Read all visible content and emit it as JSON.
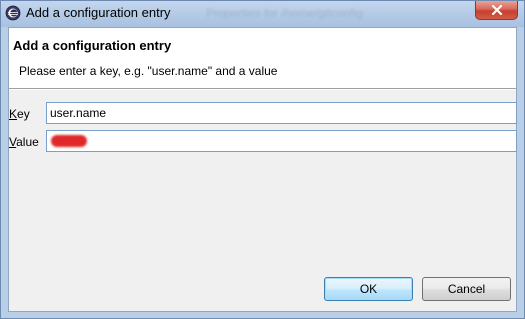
{
  "window": {
    "title": "Add a configuration entry",
    "background_title_text": "Properties for /home/gitconfig"
  },
  "header": {
    "title": "Add a configuration entry",
    "message": "Please enter a key, e.g. \"user.name\" and a value"
  },
  "form": {
    "key_label": "Key",
    "key_value": "user.name",
    "value_label": "Value",
    "value_value": ""
  },
  "buttons": {
    "ok": "OK",
    "cancel": "Cancel"
  },
  "colors": {
    "titlebar": "#b9cfe7",
    "close_button": "#c6402e",
    "default_button_border": "#3c7fb1",
    "field_border": "#7aa0c9",
    "redaction": "#e0282a"
  }
}
